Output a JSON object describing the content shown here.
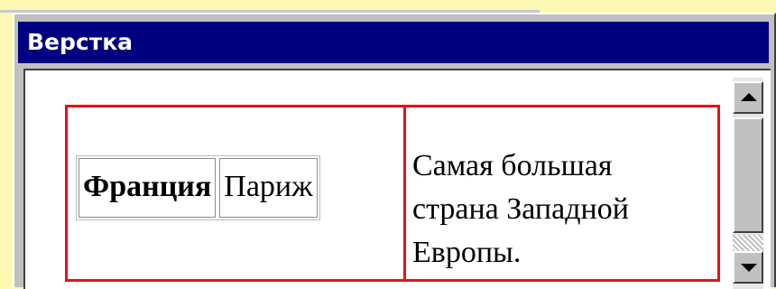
{
  "window": {
    "title": "Верстка"
  },
  "table": {
    "country": "Франция",
    "capital": "Париж"
  },
  "description": {
    "lines": [
      "Самая большая",
      "страна Западной",
      "Европы."
    ]
  },
  "scrollbar": {
    "up_icon": "arrow-up-icon",
    "down_icon": "arrow-down-icon"
  },
  "colors": {
    "title_bar": "#000080",
    "frame_outline": "#e8101a",
    "background": "#fdf9b4"
  }
}
